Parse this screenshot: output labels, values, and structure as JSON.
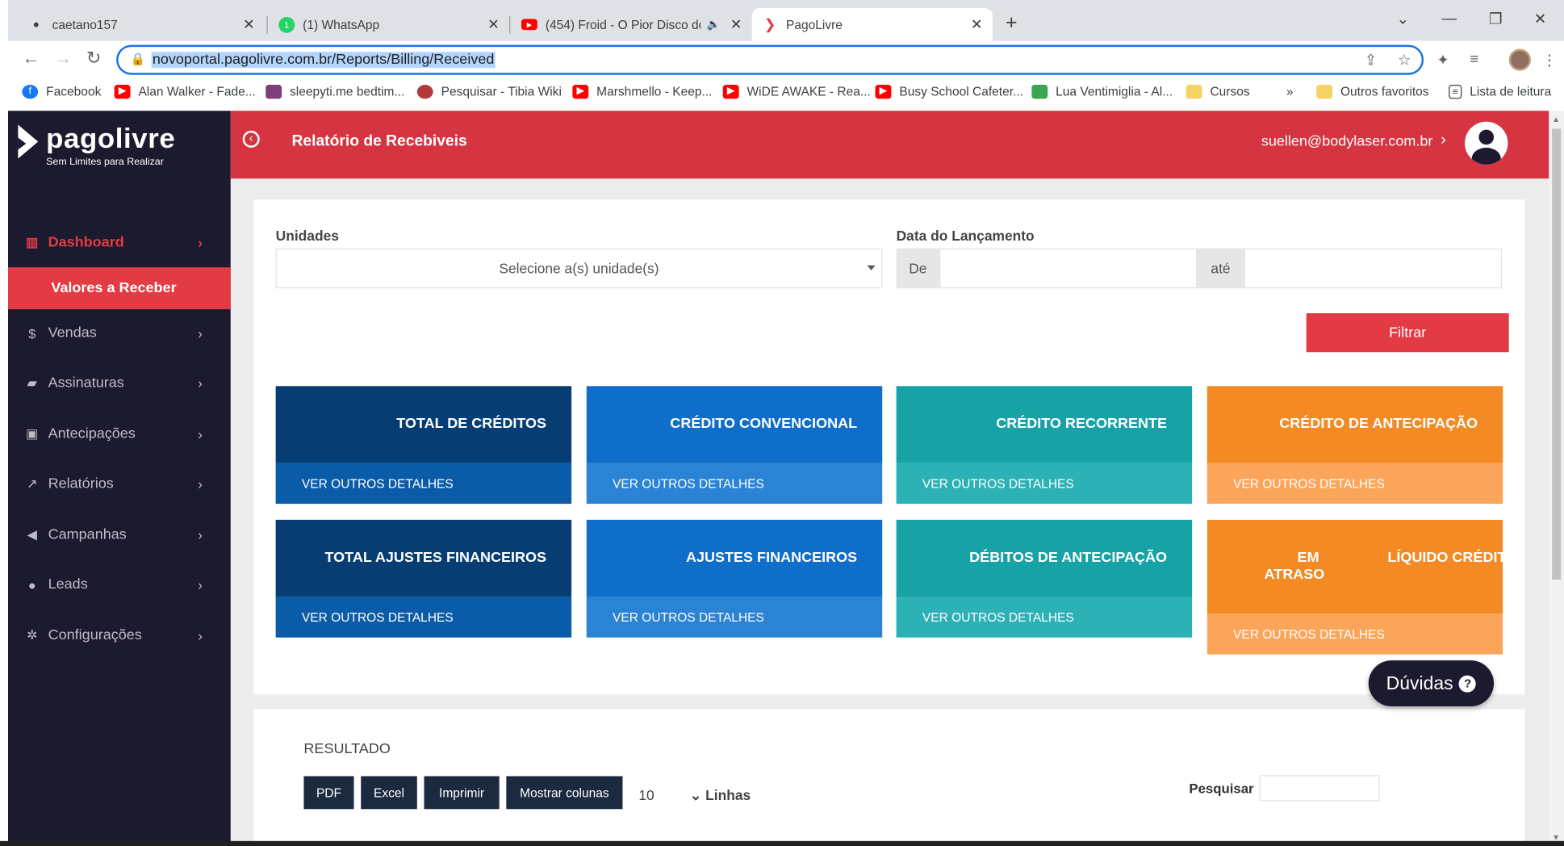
{
  "browser": {
    "tabs": [
      {
        "title": "caetano157",
        "icon": "github-icon"
      },
      {
        "title": "(1) WhatsApp",
        "icon": "whatsapp-icon"
      },
      {
        "title": "(454) Froid - O Pior Disco do",
        "icon": "youtube-icon"
      },
      {
        "title": "PagoLivre",
        "icon": "pagolivre-icon"
      }
    ],
    "url": "novoportal.pagolivre.com.br/Reports/Billing/Received",
    "bookmarks": [
      {
        "label": "Facebook",
        "color": "#1877f2"
      },
      {
        "label": "Alan Walker - Fade...",
        "color": "#ff0000"
      },
      {
        "label": "sleepyti.me bedtim...",
        "color": "#7b3f7a"
      },
      {
        "label": "Pesquisar - Tibia Wiki",
        "color": "#b33a3a"
      },
      {
        "label": "Marshmello - Keep...",
        "color": "#ff0000"
      },
      {
        "label": "WiDE AWAKE - Rea...",
        "color": "#ff0000"
      },
      {
        "label": "Busy School Cafeter...",
        "color": "#ff0000"
      },
      {
        "label": "Lua Ventimiglia - Al...",
        "color": "#3aa655"
      },
      {
        "label": "Cursos",
        "color": "#f6d365"
      }
    ],
    "bookmarks_more": "»",
    "favorites": "Outros favoritos",
    "reading_list": "Lista de leitura"
  },
  "brand": {
    "name": "pagolivre",
    "tagline": "Sem Limites para Realizar",
    "accent": "#e23b44",
    "sidebar_bg": "#1c1a2e"
  },
  "sidebar": {
    "dashboard": "Dashboard",
    "active_sub": "Valores a Receber",
    "items": [
      {
        "label": "Vendas",
        "icon": "dollar-icon"
      },
      {
        "label": "Assinaturas",
        "icon": "book-icon"
      },
      {
        "label": "Antecipações",
        "icon": "money-icon"
      },
      {
        "label": "Relatórios",
        "icon": "line-chart-icon"
      },
      {
        "label": "Campanhas",
        "icon": "megaphone-icon"
      },
      {
        "label": "Leads",
        "icon": "users-icon"
      },
      {
        "label": "Configurações",
        "icon": "cogs-icon"
      }
    ]
  },
  "header": {
    "title": "Relatório de Recebiveis",
    "user": "suellen@bodylaser.com.br"
  },
  "filters": {
    "units_label": "Unidades",
    "units_placeholder": "Selecione a(s) unidade(s)",
    "date_label": "Data do Lançamento",
    "from": "De",
    "to": "até",
    "submit": "Filtrar"
  },
  "cards": [
    {
      "title": "TOTAL DE CRÉDITOS",
      "link": "VER OUTROS DETALHES"
    },
    {
      "title": "CRÉDITO CONVENCIONAL",
      "link": "VER OUTROS DETALHES"
    },
    {
      "title": "CRÉDITO RECORRENTE",
      "link": "VER OUTROS DETALHES"
    },
    {
      "title": "CRÉDITO DE ANTECIPAÇÃO",
      "link": "VER OUTROS DETALHES"
    },
    {
      "title": "TOTAL AJUSTES FINANCEIROS",
      "link": "VER OUTROS DETALHES"
    },
    {
      "title": "AJUSTES FINANCEIROS",
      "link": "VER OUTROS DETALHES"
    },
    {
      "title": "DÉBITOS DE ANTECIPAÇÃO",
      "link": "VER OUTROS DETALHES"
    },
    {
      "title_a": "EM",
      "title_b": "ATRASO",
      "title_c": "LÍQUIDO CRÉDIT",
      "link": "VER OUTROS DETALHES"
    }
  ],
  "result": {
    "title": "RESULTADO",
    "buttons": [
      "PDF",
      "Excel",
      "Imprimir",
      "Mostrar colunas"
    ],
    "page_size": "10",
    "lines": "Linhas",
    "search_label": "Pesquisar"
  },
  "help": {
    "label": "Dúvidas",
    "icon": "?"
  }
}
